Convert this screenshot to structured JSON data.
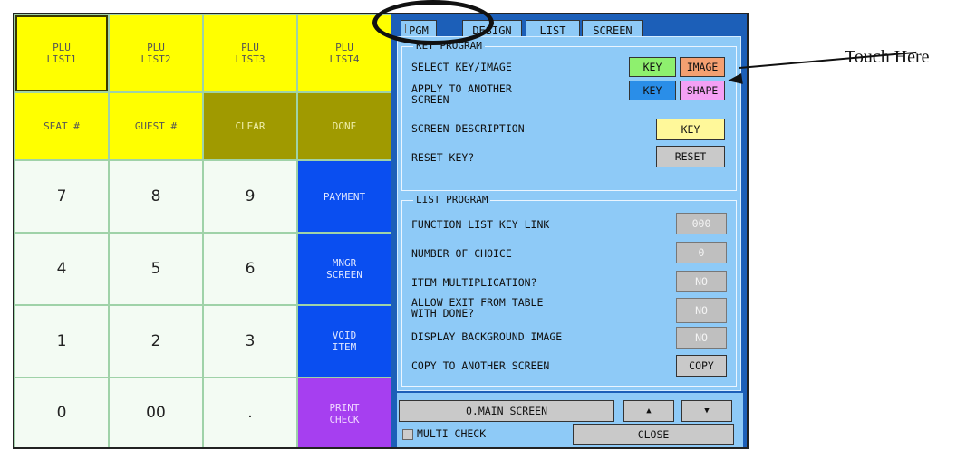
{
  "keypad": {
    "row1": [
      "PLU\nLIST1",
      "PLU\nLIST2",
      "PLU\nLIST3",
      "PLU\nLIST4"
    ],
    "row2": [
      "SEAT #",
      "GUEST #",
      "CLEAR",
      "DONE"
    ],
    "row3": [
      "7",
      "8",
      "9",
      "PAYMENT"
    ],
    "row4": [
      "4",
      "5",
      "6",
      "MNGR\nSCREEN"
    ],
    "row5": [
      "1",
      "2",
      "3",
      "VOID\nITEM"
    ],
    "row6": [
      "0",
      "00",
      ".",
      "PRINT\nCHECK"
    ]
  },
  "tabs": [
    "PGM",
    "DESIGN",
    "LIST",
    "SCREEN"
  ],
  "key_program": {
    "title": "KEY PROGRAM",
    "select_label": "SELECT KEY/IMAGE",
    "select_key": "KEY",
    "select_image": "IMAGE",
    "apply_label": "APPLY TO ANOTHER\nSCREEN",
    "apply_key": "KEY",
    "apply_shape": "SHAPE",
    "desc_label": "SCREEN DESCRIPTION",
    "desc_key": "KEY",
    "reset_label": "RESET KEY?",
    "reset_btn": "RESET"
  },
  "list_program": {
    "title": "LIST PROGRAM",
    "link_label": "FUNCTION LIST KEY LINK",
    "link_val": "000",
    "choice_label": "NUMBER OF CHOICE",
    "choice_val": "0",
    "mult_label": "ITEM MULTIPLICATION?",
    "mult_val": "NO",
    "exit_label": "ALLOW EXIT FROM TABLE\nWITH DONE?",
    "exit_val": "NO",
    "bg_label": "DISPLAY BACKGROUND IMAGE",
    "bg_val": "NO",
    "copy_label": "COPY TO ANOTHER SCREEN",
    "copy_btn": "COPY"
  },
  "bottom": {
    "screen_select": "0.MAIN SCREEN",
    "up": "▲",
    "down": "▼",
    "multi_check": "MULTI CHECK",
    "close": "CLOSE"
  },
  "annotation": {
    "touch_here": "Touch Here"
  }
}
